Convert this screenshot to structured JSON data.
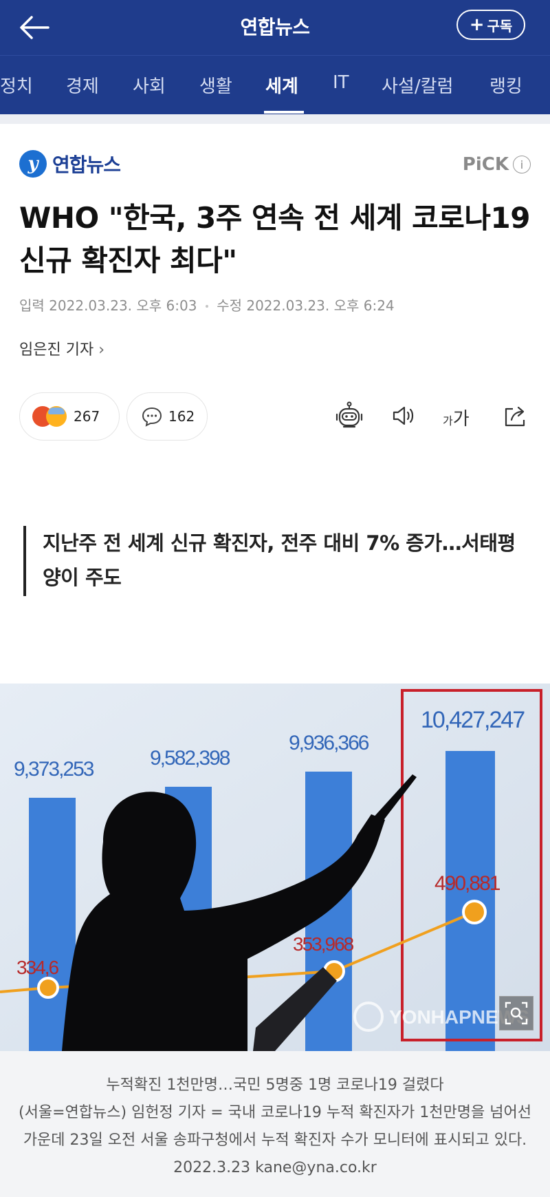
{
  "appbar": {
    "title": "연합뉴스",
    "subscribe_label": "구독"
  },
  "tabs": [
    {
      "label": "정치",
      "active": false
    },
    {
      "label": "경제",
      "active": false
    },
    {
      "label": "사회",
      "active": false
    },
    {
      "label": "생활",
      "active": false
    },
    {
      "label": "세계",
      "active": true
    },
    {
      "label": "IT",
      "active": false
    },
    {
      "label": "사설/칼럼",
      "active": false
    },
    {
      "label": "랭킹",
      "active": false
    }
  ],
  "press": {
    "name": "연합뉴스",
    "pick_label": "PiCK",
    "info_symbol": "i"
  },
  "article": {
    "title": "WHO \"한국, 3주 연속 전 세계 코로나19 신규 확진자 최다\"",
    "input_label": "입력",
    "input_time": "2022.03.23. 오후 6:03",
    "modified_label": "수정",
    "modified_time": "2022.03.23. 오후 6:24",
    "reporter": "임은진 기자",
    "reaction_count": "267",
    "comment_count": "162",
    "font_size_label_small": "가",
    "font_size_label_large": "가",
    "subtitle": "지난주 전 세계 신규 확진자, 전주 대비 7% 증가…서태평양이 주도"
  },
  "photo": {
    "bar_labels": [
      "9,373,253",
      "9,582,398",
      "9,936,366",
      "10,427,247"
    ],
    "line_labels": [
      "334,6",
      "353,968",
      "490,881"
    ],
    "watermark": "YONHAPNEWS",
    "caption_title": "누적확진 1천만명…국민 5명중 1명 코로나19 걸렸다",
    "caption_body": "(서울=연합뉴스) 임헌정 기자 = 국내 코로나19 누적 확진자가 1천만명을 넘어선 가운데 23일 오전 서울 송파구청에서 누적 확진자 수가 모니터에 표시되고 있다. 2022.3.23 kane@yna.co.kr"
  },
  "colors": {
    "brand": "#1f3c8c",
    "bar_blue": "#3d7fd8",
    "highlight_red": "#c8202a",
    "line_orange": "#f0a01e"
  }
}
